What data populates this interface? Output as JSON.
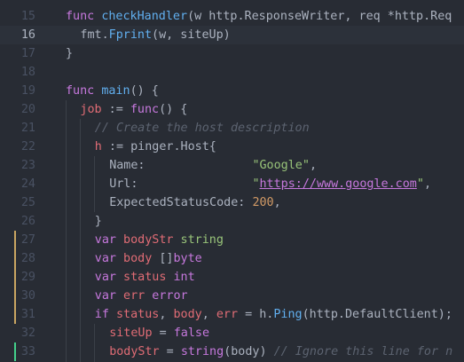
{
  "editor": {
    "lines": [
      {
        "num": "15",
        "active": false,
        "git": "",
        "indent": 0,
        "tokens": [
          {
            "t": "kw",
            "v": "func "
          },
          {
            "t": "fn",
            "v": "checkHandler"
          },
          {
            "t": "plain",
            "v": "(w http.ResponseWriter, req *http.Req"
          }
        ]
      },
      {
        "num": "16",
        "active": true,
        "git": "",
        "indent": 1,
        "tokens": [
          {
            "t": "plain",
            "v": "fmt."
          },
          {
            "t": "fn",
            "v": "Fprint"
          },
          {
            "t": "plain",
            "v": "(w, siteUp)"
          }
        ]
      },
      {
        "num": "17",
        "active": false,
        "git": "",
        "indent": 0,
        "tokens": [
          {
            "t": "plain",
            "v": "}"
          }
        ]
      },
      {
        "num": "18",
        "active": false,
        "git": "",
        "indent": 0,
        "tokens": []
      },
      {
        "num": "19",
        "active": false,
        "git": "",
        "indent": 0,
        "tokens": [
          {
            "t": "kw",
            "v": "func "
          },
          {
            "t": "fn",
            "v": "main"
          },
          {
            "t": "plain",
            "v": "() {"
          }
        ]
      },
      {
        "num": "20",
        "active": false,
        "git": "",
        "indent": 1,
        "tokens": [
          {
            "t": "var",
            "v": "job"
          },
          {
            "t": "plain",
            "v": " := "
          },
          {
            "t": "kw",
            "v": "func"
          },
          {
            "t": "plain",
            "v": "() {"
          }
        ]
      },
      {
        "num": "21",
        "active": false,
        "git": "",
        "indent": 2,
        "tokens": [
          {
            "t": "cm",
            "v": "// Create the host description"
          }
        ]
      },
      {
        "num": "22",
        "active": false,
        "git": "",
        "indent": 2,
        "tokens": [
          {
            "t": "var",
            "v": "h"
          },
          {
            "t": "plain",
            "v": " := pinger.Host{"
          }
        ]
      },
      {
        "num": "23",
        "active": false,
        "git": "",
        "indent": 3,
        "tokens": [
          {
            "t": "plain",
            "v": "Name:               "
          },
          {
            "t": "str",
            "v": "\"Google\""
          },
          {
            "t": "plain",
            "v": ","
          }
        ]
      },
      {
        "num": "24",
        "active": false,
        "git": "",
        "indent": 3,
        "tokens": [
          {
            "t": "plain",
            "v": "Url:                "
          },
          {
            "t": "str",
            "v": "\""
          },
          {
            "t": "url",
            "v": "https://www.google.com"
          },
          {
            "t": "str",
            "v": "\""
          },
          {
            "t": "plain",
            "v": ","
          }
        ]
      },
      {
        "num": "25",
        "active": false,
        "git": "",
        "indent": 3,
        "tokens": [
          {
            "t": "plain",
            "v": "ExpectedStatusCode: "
          },
          {
            "t": "num",
            "v": "200"
          },
          {
            "t": "plain",
            "v": ","
          }
        ]
      },
      {
        "num": "26",
        "active": false,
        "git": "",
        "indent": 2,
        "tokens": [
          {
            "t": "plain",
            "v": "}"
          }
        ]
      },
      {
        "num": "27",
        "active": false,
        "git": "modified",
        "indent": 2,
        "tokens": [
          {
            "t": "kw",
            "v": "var "
          },
          {
            "t": "var",
            "v": "bodyStr"
          },
          {
            "t": "plain",
            "v": " "
          },
          {
            "t": "str",
            "v": "string"
          }
        ]
      },
      {
        "num": "28",
        "active": false,
        "git": "modified",
        "indent": 2,
        "tokens": [
          {
            "t": "kw",
            "v": "var "
          },
          {
            "t": "var",
            "v": "body"
          },
          {
            "t": "plain",
            "v": " []"
          },
          {
            "t": "kw",
            "v": "byte"
          }
        ]
      },
      {
        "num": "29",
        "active": false,
        "git": "modified",
        "indent": 2,
        "tokens": [
          {
            "t": "kw",
            "v": "var "
          },
          {
            "t": "var",
            "v": "status"
          },
          {
            "t": "plain",
            "v": " "
          },
          {
            "t": "kw",
            "v": "int"
          }
        ]
      },
      {
        "num": "30",
        "active": false,
        "git": "modified",
        "indent": 2,
        "tokens": [
          {
            "t": "kw",
            "v": "var "
          },
          {
            "t": "var",
            "v": "err"
          },
          {
            "t": "plain",
            "v": " "
          },
          {
            "t": "kw",
            "v": "error"
          }
        ]
      },
      {
        "num": "31",
        "active": false,
        "git": "modified",
        "indent": 2,
        "tokens": [
          {
            "t": "kw",
            "v": "if "
          },
          {
            "t": "var",
            "v": "status"
          },
          {
            "t": "plain",
            "v": ", "
          },
          {
            "t": "var",
            "v": "body"
          },
          {
            "t": "plain",
            "v": ", "
          },
          {
            "t": "var",
            "v": "err"
          },
          {
            "t": "plain",
            "v": " = h."
          },
          {
            "t": "fn",
            "v": "Ping"
          },
          {
            "t": "plain",
            "v": "(http.DefaultClient);"
          }
        ]
      },
      {
        "num": "32",
        "active": false,
        "git": "",
        "indent": 3,
        "tokens": [
          {
            "t": "var",
            "v": "siteUp"
          },
          {
            "t": "plain",
            "v": " = "
          },
          {
            "t": "kw",
            "v": "false"
          }
        ]
      },
      {
        "num": "33",
        "active": false,
        "git": "added",
        "indent": 3,
        "tokens": [
          {
            "t": "var",
            "v": "bodyStr"
          },
          {
            "t": "plain",
            "v": " = "
          },
          {
            "t": "kw",
            "v": "string"
          },
          {
            "t": "plain",
            "v": "(body) "
          },
          {
            "t": "cm",
            "v": "// Ignore this line for n"
          }
        ]
      }
    ]
  }
}
